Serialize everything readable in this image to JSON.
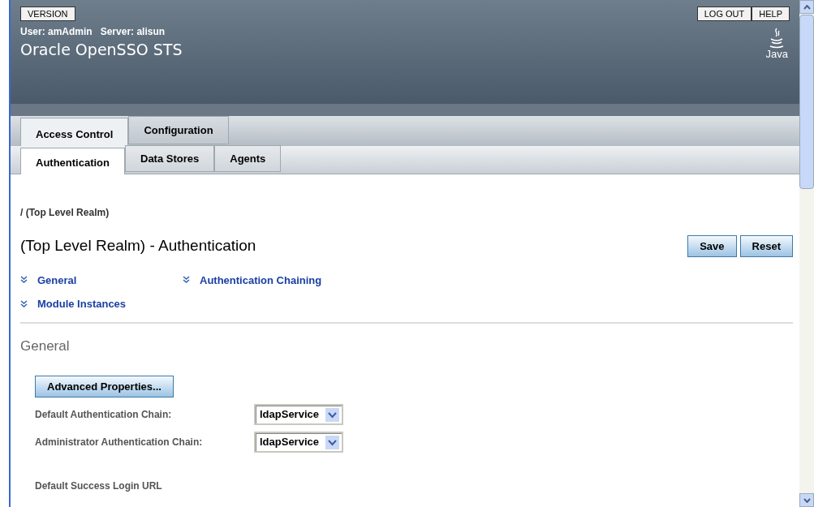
{
  "masthead": {
    "version_button": "VERSION",
    "buttons": [
      "LOG OUT",
      "HELP"
    ],
    "user_info": "User: amAdmin   Server: alisun",
    "product_name": "Oracle OpenSSO STS",
    "logo_text": "Java"
  },
  "tabs": [
    {
      "label": "Access Control",
      "selected": true
    },
    {
      "label": "Configuration",
      "selected": false
    }
  ],
  "subtabs": [
    {
      "label": "Authentication",
      "selected": true
    },
    {
      "label": "Data Stores",
      "selected": false
    },
    {
      "label": "Agents",
      "selected": false
    }
  ],
  "breadcrumb": "/ (Top Level Realm)",
  "page_title": "(Top Level Realm) - Authentication",
  "actions": [
    "Save",
    "Reset"
  ],
  "jump_links": [
    "General",
    "Authentication Chaining",
    "Module Instances"
  ],
  "section_title": "General",
  "advanced_button": "Advanced Properties...",
  "fields": [
    {
      "label": "Default Authentication Chain:",
      "value": "ldapService"
    },
    {
      "label": "Administrator Authentication Chain:",
      "value": "ldapService"
    }
  ],
  "next_field_label": "Default Success Login URL"
}
